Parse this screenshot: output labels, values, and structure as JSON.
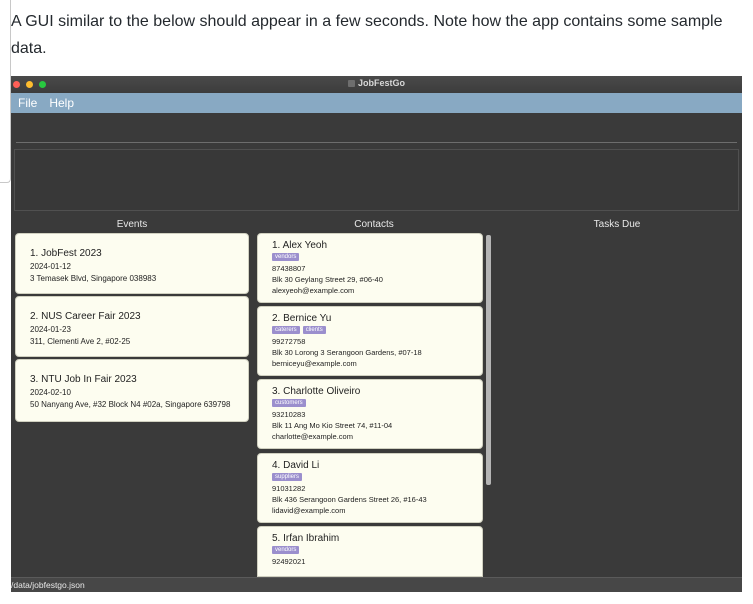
{
  "intro": {
    "text": "A GUI similar to the below should appear in a few seconds. Note how the app contains some sample data."
  },
  "window": {
    "title": "JobFestGo",
    "menu": [
      "File",
      "Help"
    ],
    "status_path": "/data/jobfestgo.json"
  },
  "columns": {
    "events": "Events",
    "contacts": "Contacts",
    "tasks": "Tasks Due"
  },
  "events": [
    {
      "title": "1.  JobFest 2023",
      "date": "2024-01-12",
      "address": "3 Temasek Blvd, Singapore 038983"
    },
    {
      "title": "2.  NUS Career Fair 2023",
      "date": "2024-01-23",
      "address": "311, Clementi Ave 2, #02-25"
    },
    {
      "title": "3.  NTU Job In Fair 2023",
      "date": "2024-02-10",
      "address": "50 Nanyang Ave, #32 Block N4 #02a, Singapore 639798"
    }
  ],
  "contacts": [
    {
      "title": "1.  Alex Yeoh",
      "tags": [
        "vendors"
      ],
      "phone": "87438807",
      "address": "Blk 30 Geylang Street 29, #06-40",
      "email": "alexyeoh@example.com"
    },
    {
      "title": "2.  Bernice Yu",
      "tags": [
        "caterers",
        "clients"
      ],
      "phone": "99272758",
      "address": "Blk 30 Lorong 3 Serangoon Gardens, #07-18",
      "email": "berniceyu@example.com"
    },
    {
      "title": "3.  Charlotte Oliveiro",
      "tags": [
        "customers"
      ],
      "phone": "93210283",
      "address": "Blk 11 Ang Mo Kio Street 74, #11-04",
      "email": "charlotte@example.com"
    },
    {
      "title": "4.  David Li",
      "tags": [
        "suppliers"
      ],
      "phone": "91031282",
      "address": "Blk 436 Serangoon Gardens Street 26, #16-43",
      "email": "lidavid@example.com"
    },
    {
      "title": "5.  Irfan Ibrahim",
      "tags": [
        "vendors"
      ],
      "phone": "92492021",
      "address": "",
      "email": ""
    }
  ],
  "colors": {
    "menubar": "#88a9c3",
    "window_bg": "#3a3a3a",
    "card_bg": "#fdfdf0",
    "tag_bg": "#9b8fcd"
  }
}
